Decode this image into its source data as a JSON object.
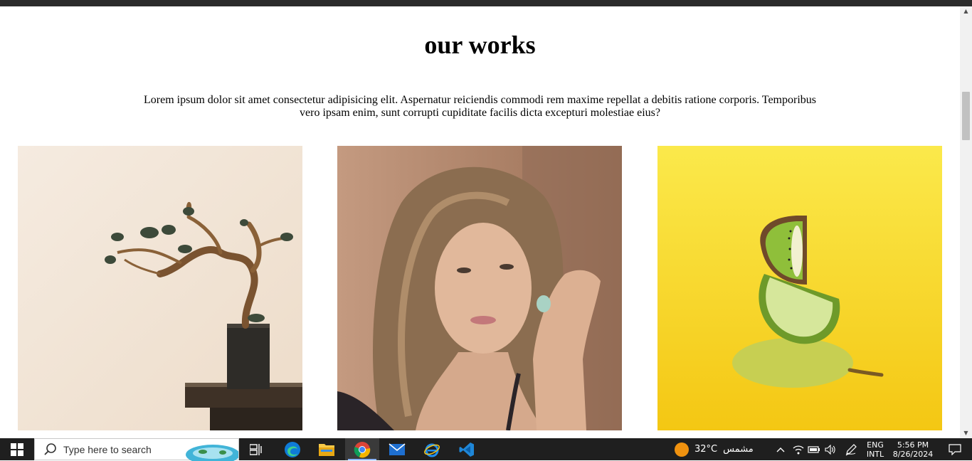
{
  "page": {
    "title": "our works",
    "description": "Lorem ipsum dolor sit amet consectetur adipisicing elit. Aspernatur reiciendis commodi rem maxime repellat a debitis ratione corporis. Temporibus vero ipsam enim, sunt corrupti cupiditate facilis dicta excepturi molestiae eius?"
  },
  "gallery": [
    {
      "subject": "bonsai tree on pedestal",
      "bg": "#efe4d6"
    },
    {
      "subject": "woman leaning on stone wall",
      "bg": "#a98064"
    },
    {
      "subject": "kiwi, lime and pear stacked",
      "bg": "#f6dc2a"
    }
  ],
  "taskbar": {
    "search_placeholder": "Type here to search",
    "apps": [
      "start-icon",
      "task-view-icon",
      "edge-icon",
      "file-explorer-icon",
      "chrome-icon",
      "mail-icon",
      "internet-explorer-icon",
      "vscode-icon"
    ],
    "weather": {
      "temp": "32°C",
      "condition": "مشمس"
    },
    "language": {
      "line1": "ENG",
      "line2": "INTL"
    },
    "clock": {
      "time": "5:56 PM",
      "date": "8/26/2024"
    }
  },
  "colors": {
    "taskbar_bg": "#1f1f1f",
    "chrome_active": "#3a3a3a",
    "weather_sun": "#f0920f"
  }
}
